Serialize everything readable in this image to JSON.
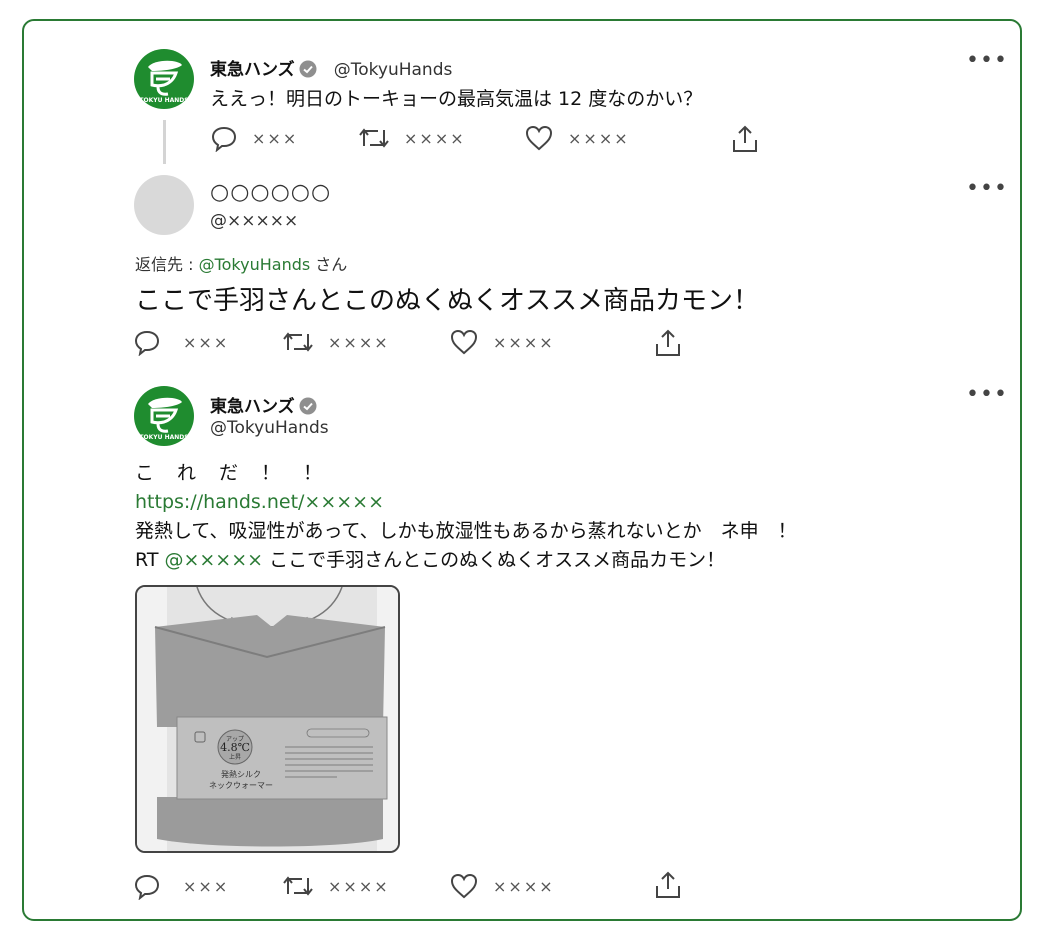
{
  "tweet1": {
    "name": "東急ハンズ",
    "handle": "@TokyuHands",
    "text": "ええっ！明日のトーキョーの最高気温は 12 度なのかい？",
    "avatar_text": "TOKYU HANDS",
    "reply_count": "×××",
    "retweet_count": "××××",
    "like_count": "××××"
  },
  "tweet2": {
    "name": "○○○○○○",
    "handle": "@×××××",
    "reply_to_prefix": "返信先 : ",
    "reply_to_handle": "@TokyuHands",
    "reply_to_suffix": " さん",
    "text": "ここで手羽さんとこのぬくぬくオススメ商品カモン！",
    "reply_count": "×××",
    "retweet_count": "××××",
    "like_count": "××××"
  },
  "tweet3": {
    "name": "東急ハンズ",
    "handle": "@TokyuHands",
    "avatar_text": "TOKYU HANDS",
    "line1": "こ　れ　だ　！　！",
    "link": "https://hands.net/×××××",
    "line3": "発熱して、吸湿性があって、しかも放湿性もあるから蒸れないとか　ネ申　！",
    "rt_prefix": "RT ",
    "rt_handle": "@×××××",
    "rt_text": " ここで手羽さんとこのぬくぬくオススメ商品カモン！",
    "product": {
      "badge_value": "4.8℃",
      "badge_top": "アップ",
      "badge_bottom": "上昇",
      "title_line1": "発熱シルク",
      "title_line2": "ネックウォーマー"
    },
    "reply_count": "×××",
    "retweet_count": "××××",
    "like_count": "××××"
  },
  "icons": [
    "reply-icon",
    "retweet-icon",
    "like-icon",
    "share-icon",
    "more-icon",
    "verified-icon"
  ],
  "colors": {
    "brand_green": "#1f8c2f",
    "link_green": "#2a7a34",
    "frame_green": "#2a7a34"
  }
}
